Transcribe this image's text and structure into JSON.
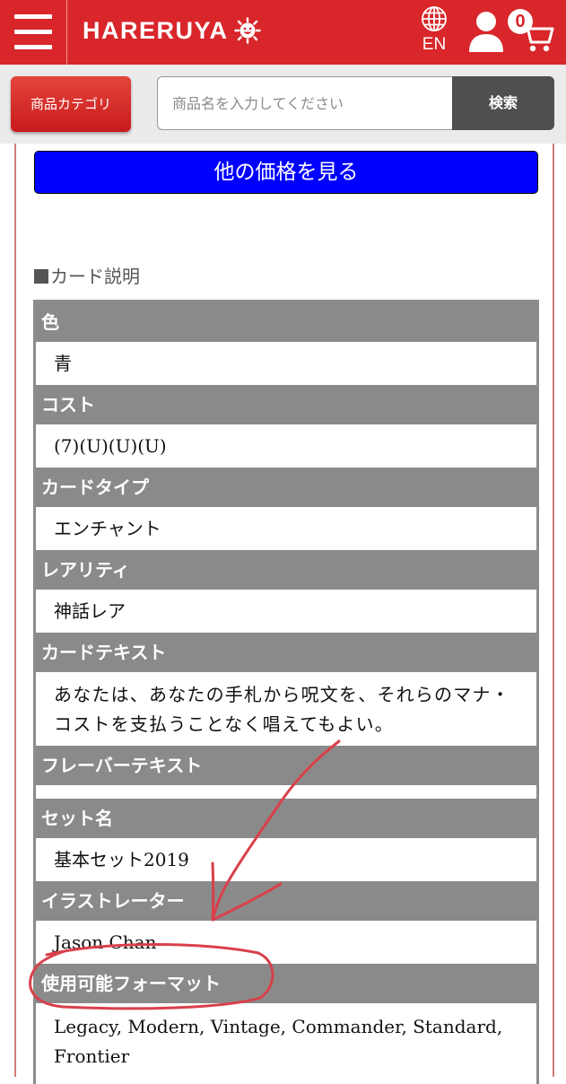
{
  "header": {
    "logo_text": "HARERUYA",
    "lang_label": "EN",
    "cart_count": "0",
    "accent_color": "#d8262a"
  },
  "search": {
    "category_button": "商品カテゴリ",
    "placeholder": "商品名を入力してください",
    "search_button": "検索"
  },
  "main": {
    "other_price_button": "他の価格を見る",
    "section_title": "カード説明",
    "specs": [
      {
        "label": "色",
        "value": "青"
      },
      {
        "label": "コスト",
        "value": "(7)(U)(U)(U)"
      },
      {
        "label": "カードタイプ",
        "value": "エンチャント"
      },
      {
        "label": "レアリティ",
        "value": "神話レア"
      },
      {
        "label": "カードテキスト",
        "value": "あなたは、あなたの手札から呪文を、それらのマナ・コストを支払うことなく唱えてもよい。"
      },
      {
        "label": "フレーバーテキスト",
        "value": ""
      },
      {
        "label": "セット名",
        "value": "基本セット2019"
      },
      {
        "label": "イラストレーター",
        "value": "Jason Chan"
      },
      {
        "label": "使用可能フォーマット",
        "value": "Legacy, Modern, Vintage, Commander, Standard, Frontier"
      }
    ]
  },
  "icons": {
    "menu": "hamburger-menu-icon",
    "logo_mark": "sun-face-icon",
    "lang": "globe-icon",
    "user": "user-icon",
    "cart": "cart-icon"
  },
  "annotation": {
    "color": "#d9404a"
  }
}
